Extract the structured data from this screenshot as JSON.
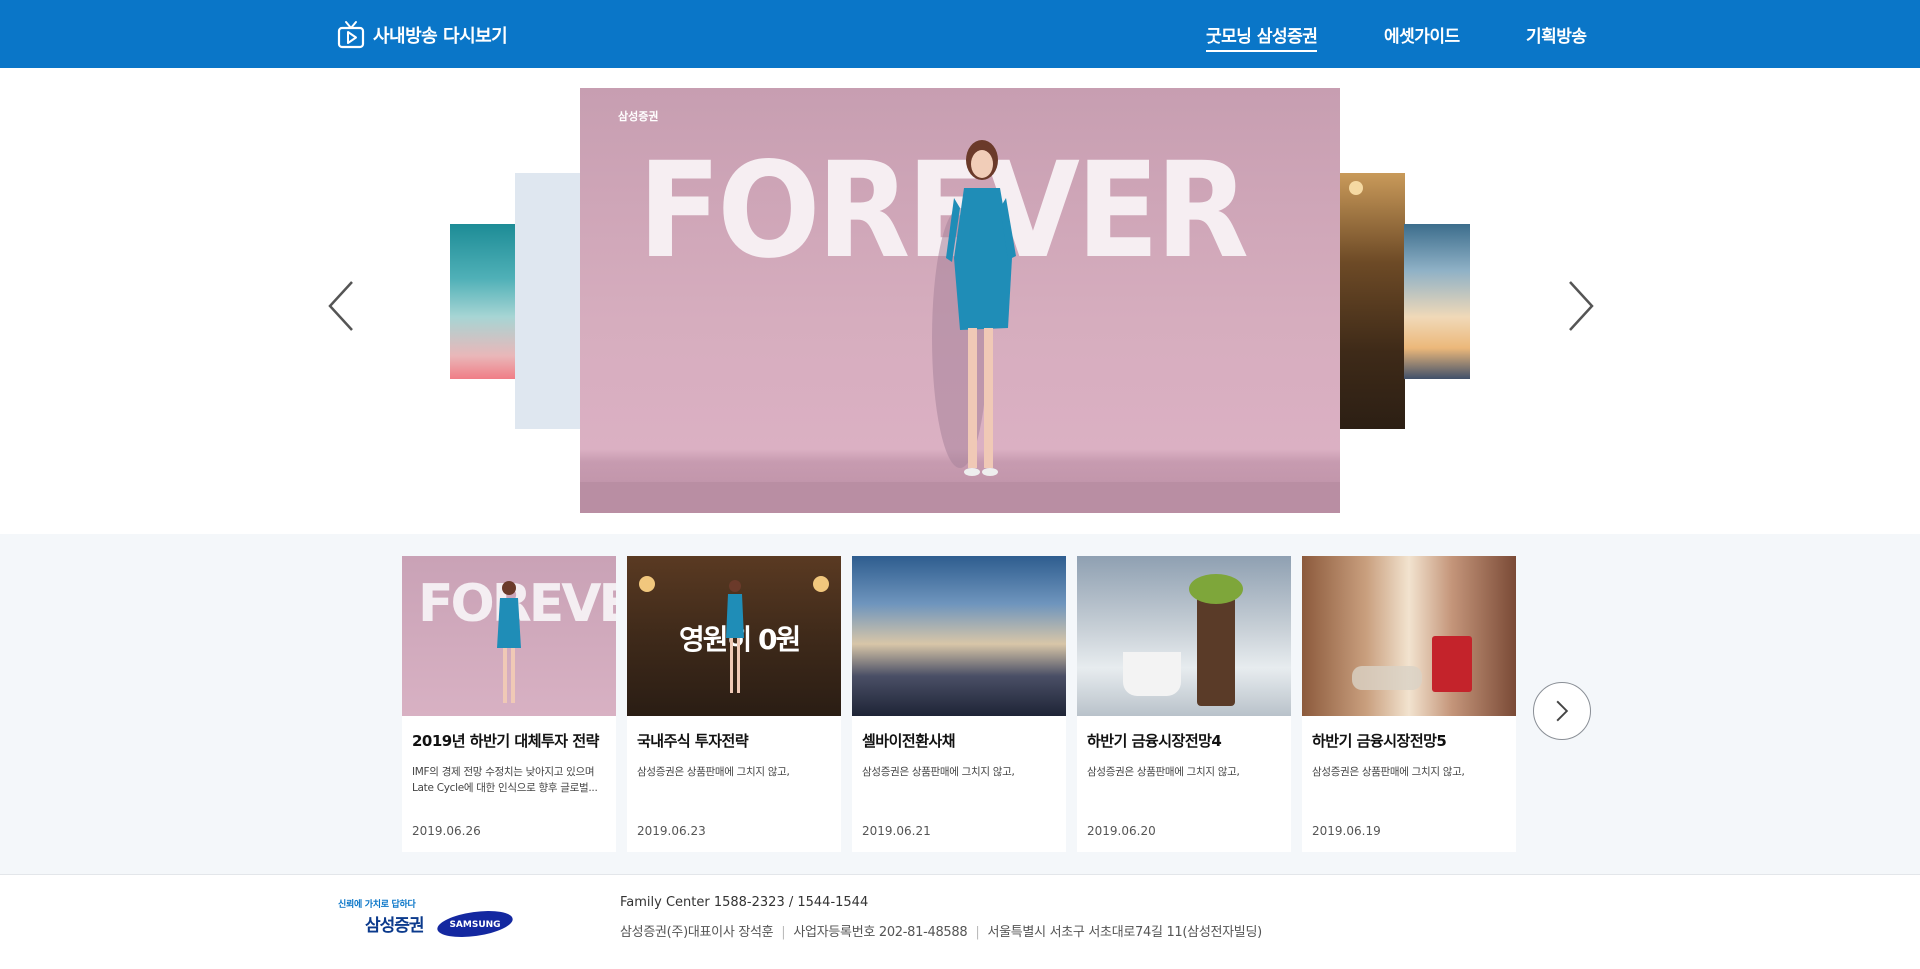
{
  "header": {
    "brand": "사내방송 다시보기",
    "nav": [
      "굿모닝 삼성증권",
      "에셋가이드",
      "기획방송"
    ],
    "active_nav": "굿모닝 삼성증권",
    "brand_color": "#0a76c8"
  },
  "hero": {
    "main_slide": {
      "brand_tag": "삼성증권",
      "headline": "FOREVER"
    }
  },
  "cards": [
    {
      "title": "2019년 하반기 대체투자 전략",
      "desc": "IMF의 경제 전망 수정치는 낮아지고 있으며 Late Cycle에 대한 인식으로 향후 글로벌...",
      "date": "2019.06.26",
      "thumb_text": "FOREVER"
    },
    {
      "title": "국내주식 투자전략",
      "desc": "삼성증권은 상품판매에 그치지 않고,",
      "date": "2019.06.23",
      "thumb_text": "영원히 0원"
    },
    {
      "title": "셀바이전환사채",
      "desc": "삼성증권은 상품판매에 그치지 않고,",
      "date": "2019.06.21"
    },
    {
      "title": "하반기 금융시장전망4",
      "desc": "삼성증권은 상품판매에 그치지 않고,",
      "date": "2019.06.20"
    },
    {
      "title": "하반기 금융시장전망5",
      "desc": "삼성증권은 상품판매에 그치지 않고,",
      "date": "2019.06.19"
    }
  ],
  "footer": {
    "slogan": "신뢰에 가치로 답하다",
    "logo_text": "삼성증권",
    "samsung_text": "SAMSUNG",
    "family_center": "Family Center 1588-2323 / 1544-1544",
    "company": "삼성증권(주)대표이사 장석훈",
    "biz_no": "사업자등록번호 202-81-48588",
    "address": "서울특별시 서초구 서초대로74길 11(삼성전자빌딩)"
  }
}
